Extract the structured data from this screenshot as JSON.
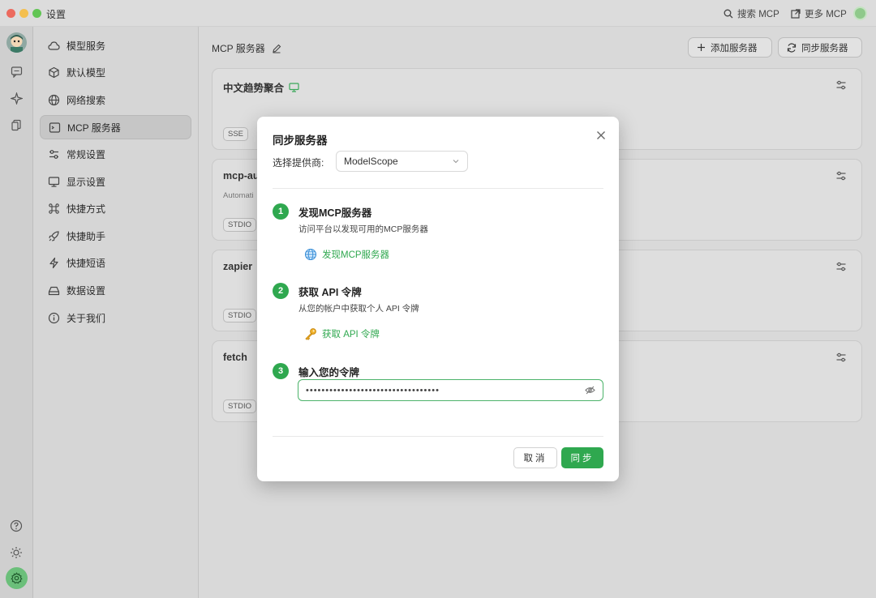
{
  "window": {
    "title": "设置"
  },
  "titlebar": {
    "search_label": "搜索 MCP",
    "more_label": "更多 MCP"
  },
  "sidebar": {
    "items": [
      {
        "label": "模型服务",
        "icon": "cloud-icon"
      },
      {
        "label": "默认模型",
        "icon": "cube-icon"
      },
      {
        "label": "网络搜索",
        "icon": "globe-icon"
      },
      {
        "label": "MCP 服务器",
        "icon": "terminal-icon",
        "active": true
      },
      {
        "label": "常规设置",
        "icon": "sliders-icon"
      },
      {
        "label": "显示设置",
        "icon": "monitor-icon"
      },
      {
        "label": "快捷方式",
        "icon": "command-icon"
      },
      {
        "label": "快捷助手",
        "icon": "rocket-icon"
      },
      {
        "label": "快捷短语",
        "icon": "zap-icon"
      },
      {
        "label": "数据设置",
        "icon": "drive-icon"
      },
      {
        "label": "关于我们",
        "icon": "info-icon"
      }
    ]
  },
  "main": {
    "title": "MCP 服务器",
    "add_label": "添加服务器",
    "sync_label": "同步服务器",
    "cards": [
      {
        "title": "中文趋势聚合",
        "desc": "",
        "badge": "SSE"
      },
      {
        "title": "mcp-au",
        "desc": "Automati",
        "badge": "STDIO"
      },
      {
        "title": "zapier",
        "desc": "",
        "badge": "STDIO"
      },
      {
        "title": "fetch",
        "desc": "",
        "badge": "STDIO"
      }
    ]
  },
  "modal": {
    "title": "同步服务器",
    "provider_label": "选择提供商:",
    "provider_value": "ModelScope",
    "steps": [
      {
        "num": "1",
        "title": "发现MCP服务器",
        "desc": "访问平台以发现可用的MCP服务器",
        "link": "发现MCP服务器",
        "icon": "globe-icon"
      },
      {
        "num": "2",
        "title": "获取 API 令牌",
        "desc": "从您的帐户中获取个人 API 令牌",
        "link": "获取 API 令牌",
        "icon": "key-icon"
      },
      {
        "num": "3",
        "title": "输入您的令牌"
      }
    ],
    "token_value": "••••••••••••••••••••••••••••••••••",
    "cancel_label": "取消",
    "confirm_label": "同步"
  },
  "colors": {
    "accent": "#2fa84f"
  }
}
